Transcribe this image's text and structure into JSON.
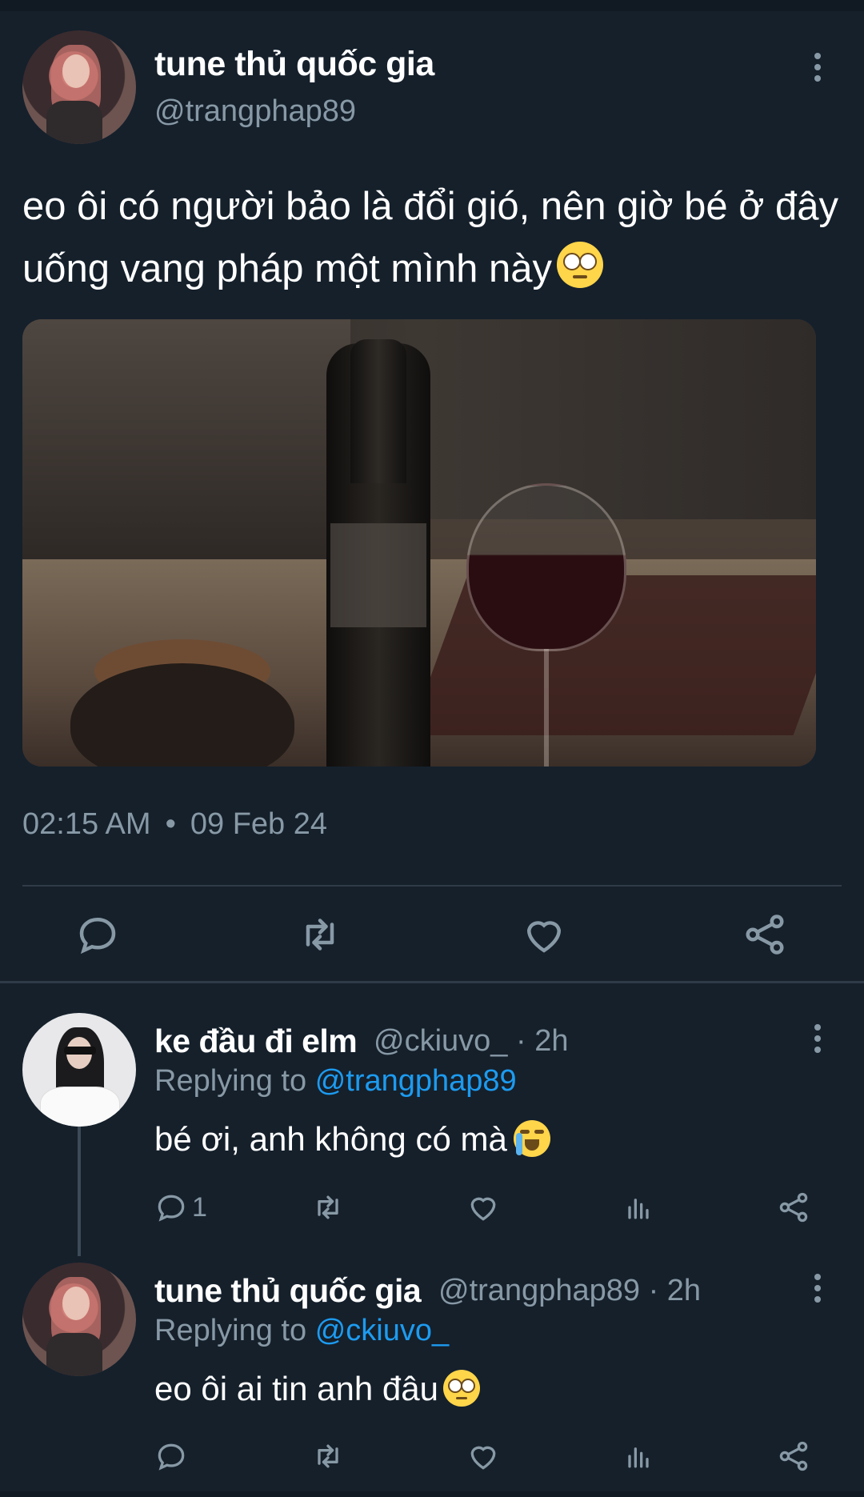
{
  "tweet": {
    "author_name": "tune thủ quốc gia",
    "author_handle": "@trangphap89",
    "text": "eo ôi có người bảo là đổi gió, nên giờ bé ở đây uống vang pháp một mình này",
    "time": "02:15 AM",
    "dot": "•",
    "date": "09 Feb 24",
    "actions": [
      "reply-icon",
      "retweet-icon",
      "like-icon",
      "share-icon"
    ]
  },
  "replies": [
    {
      "name": "ke đầu đi elm",
      "handle": "@ckiuvo_",
      "meta_suffix": "· 2h",
      "replying_prefix": "Replying to",
      "replying_to": "@trangphap89",
      "text": "bé ơi, anh không có mà",
      "reply_count": "1"
    },
    {
      "name": "tune thủ quốc gia",
      "handle": "@trangphap89",
      "meta_suffix": "· 2h",
      "replying_prefix": "Replying to",
      "replying_to": "@ckiuvo_",
      "text": "eo ôi ai tin anh đâu",
      "reply_count": ""
    }
  ],
  "colors": {
    "background": "#15202b",
    "muted": "#8899a6",
    "link": "#1d9bf0",
    "divider": "#2f3b47"
  }
}
